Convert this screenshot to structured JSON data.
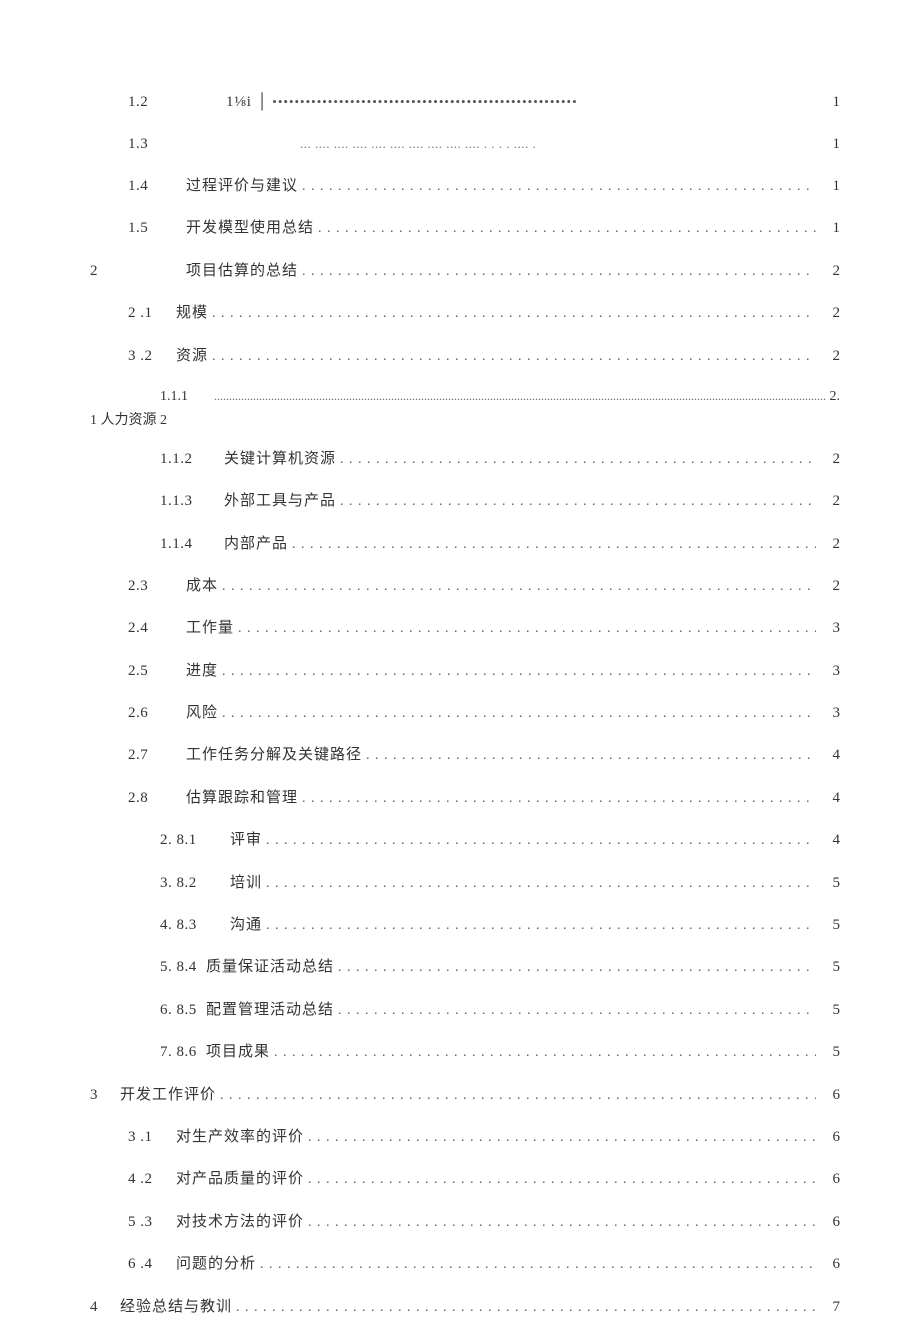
{
  "toc": {
    "r01": {
      "num": "1.2",
      "label": "1⅛i │",
      "page": "1"
    },
    "r02": {
      "num": "1.3",
      "label": "",
      "page": "1"
    },
    "r03": {
      "num": "1.4",
      "label": "过程评价与建议",
      "page": "1"
    },
    "r04": {
      "num": "1.5",
      "label": "开发模型使用总结",
      "page": "1"
    },
    "r05": {
      "num": "2",
      "label": "项目估算的总结",
      "page": "2"
    },
    "r06": {
      "num": "2  .1",
      "label": "规模",
      "page": "2"
    },
    "r07": {
      "num": "3  .2",
      "label": "资源",
      "page": "2"
    },
    "r08": {
      "num": "1.1.1",
      "tail": "2.",
      "bottom": "1 人力资源 2"
    },
    "r09": {
      "num": "1.1.2",
      "label": "关键计算机资源",
      "page": "2"
    },
    "r10": {
      "num": "1.1.3",
      "label": "外部工具与产品",
      "page": "2"
    },
    "r11": {
      "num": "1.1.4",
      "label": "内部产品",
      "page": "2"
    },
    "r12": {
      "num": "2.3",
      "label": "成本",
      "page": "2"
    },
    "r13": {
      "num": "2.4",
      "label": "工作量",
      "page": "3"
    },
    "r14": {
      "num": "2.5",
      "label": "进度",
      "page": "3"
    },
    "r15": {
      "num": "2.6",
      "label": "风险",
      "page": "3"
    },
    "r16": {
      "num": "2.7",
      "label": "工作任务分解及关键路径",
      "page": "4"
    },
    "r17": {
      "num": "2.8",
      "label": "估算跟踪和管理",
      "page": "4"
    },
    "r18": {
      "num": "2. 8.1",
      "label": "评审",
      "page": "4"
    },
    "r19": {
      "num": "3. 8.2",
      "label": "培训",
      "page": "5"
    },
    "r20": {
      "num": "4. 8.3",
      "label": "沟通",
      "page": "5"
    },
    "r21": {
      "num": "5. 8.4",
      "label": "质量保证活动总结",
      "page": "5"
    },
    "r22": {
      "num": "6. 8.5",
      "label": "配置管理活动总结",
      "page": "5"
    },
    "r23": {
      "num": "7. 8.6",
      "label": "项目成果",
      "page": "5"
    },
    "r24": {
      "num": "3",
      "label": "开发工作评价",
      "page": "6"
    },
    "r25": {
      "num": "3  .1",
      "label": "对生产效率的评价",
      "page": "6"
    },
    "r26": {
      "num": "4  .2",
      "label": "对产品质量的评价",
      "page": "6"
    },
    "r27": {
      "num": "5  .3",
      "label": "对技术方法的评价",
      "page": "6"
    },
    "r28": {
      "num": "6  .4",
      "label": "问题的分析",
      "page": "6"
    },
    "r29": {
      "num": "4",
      "label": "经验总结与教训",
      "page": "7"
    }
  }
}
